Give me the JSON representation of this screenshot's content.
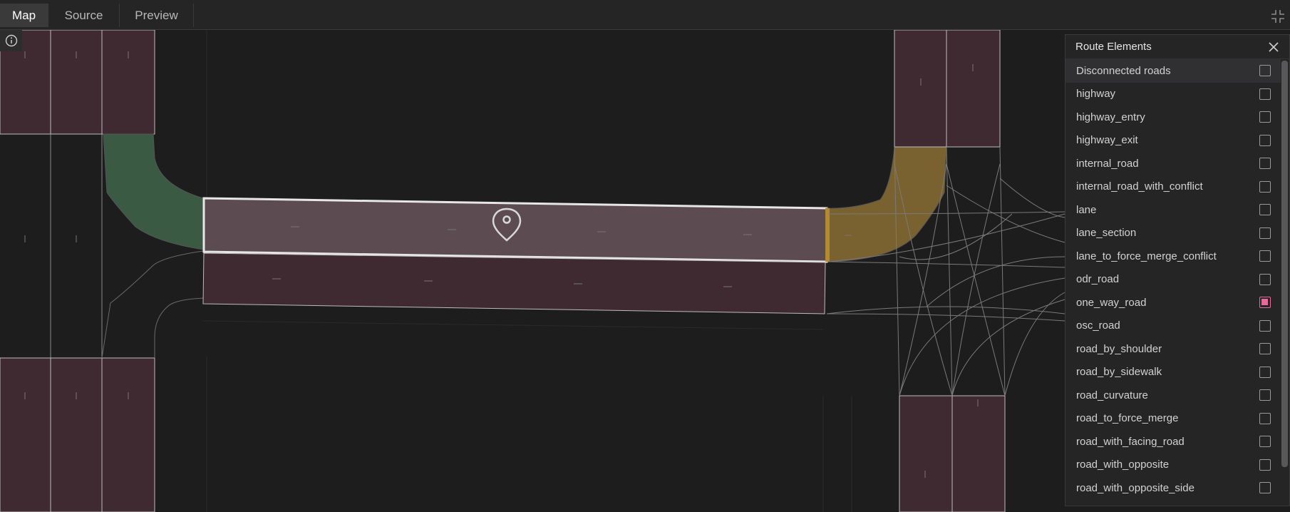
{
  "tabs": [
    {
      "label": "Map",
      "active": true
    },
    {
      "label": "Source",
      "active": false
    },
    {
      "label": "Preview",
      "active": false
    }
  ],
  "icons": {
    "collapse": "collapse-icon",
    "info": "info-icon",
    "pin": "map-pin-icon",
    "close": "close-icon"
  },
  "colors": {
    "road": "#3f2a32",
    "selected_road": "#5c4b50",
    "green_connector": "#3a5a44",
    "yellow_connector": "#7a6230",
    "checked": "#e36b9a"
  },
  "panel": {
    "title": "Route Elements",
    "items": [
      {
        "label": "Disconnected roads",
        "checked": false
      },
      {
        "label": "highway",
        "checked": false
      },
      {
        "label": "highway_entry",
        "checked": false
      },
      {
        "label": "highway_exit",
        "checked": false
      },
      {
        "label": "internal_road",
        "checked": false
      },
      {
        "label": "internal_road_with_conflict",
        "checked": false
      },
      {
        "label": "lane",
        "checked": false
      },
      {
        "label": "lane_section",
        "checked": false
      },
      {
        "label": "lane_to_force_merge_conflict",
        "checked": false
      },
      {
        "label": "odr_road",
        "checked": false
      },
      {
        "label": "one_way_road",
        "checked": true
      },
      {
        "label": "osc_road",
        "checked": false
      },
      {
        "label": "road_by_shoulder",
        "checked": false
      },
      {
        "label": "road_by_sidewalk",
        "checked": false
      },
      {
        "label": "road_curvature",
        "checked": false
      },
      {
        "label": "road_to_force_merge",
        "checked": false
      },
      {
        "label": "road_with_facing_road",
        "checked": false
      },
      {
        "label": "road_with_opposite",
        "checked": false
      },
      {
        "label": "road_with_opposite_side",
        "checked": false
      }
    ]
  }
}
